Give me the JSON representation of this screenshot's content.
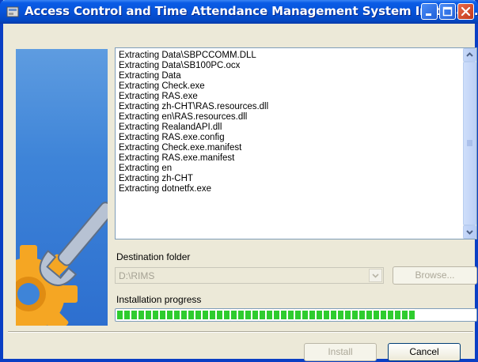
{
  "window": {
    "title": "Access Control and Time Attendance Management System Installati...",
    "controls": [
      "minimize-icon",
      "maximize-icon",
      "close-icon"
    ]
  },
  "log": {
    "lines": [
      "Extracting Data\\SBPCCOMM.DLL",
      "Extracting Data\\SB100PC.ocx",
      "Extracting Data",
      "Extracting Check.exe",
      "Extracting RAS.exe",
      "Extracting zh-CHT\\RAS.resources.dll",
      "Extracting en\\RAS.resources.dll",
      "Extracting RealandAPI.dll",
      "Extracting RAS.exe.config",
      "Extracting Check.exe.manifest",
      "Extracting RAS.exe.manifest",
      "Extracting en",
      "Extracting zh-CHT",
      "Extracting dotnetfx.exe"
    ]
  },
  "destination": {
    "label": "Destination folder",
    "value": "D:\\RIMS",
    "browse_label": "Browse..."
  },
  "progress": {
    "label": "Installation progress",
    "fraction": 0.84,
    "color": "#2ecc2e"
  },
  "buttons": {
    "install_label": "Install",
    "cancel_label": "Cancel"
  },
  "colors": {
    "titlebar": "#0653d9",
    "window_bg": "#ece9d8",
    "gear": "#f5a623",
    "wrench": "#8c9ab0"
  }
}
